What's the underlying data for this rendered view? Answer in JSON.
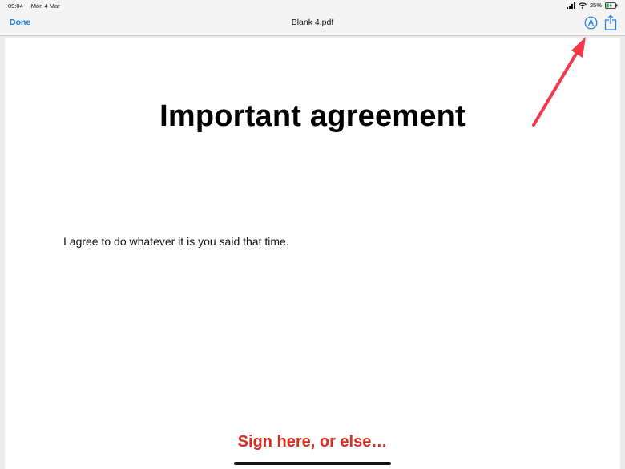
{
  "status_bar": {
    "time": "09:04",
    "date": "Mon 4 Mar",
    "battery": "25%"
  },
  "nav": {
    "done_label": "Done",
    "title": "Blank 4.pdf"
  },
  "document": {
    "heading": "Important agreement",
    "body": "I agree to do whatever it is you said that time.",
    "sign_prompt": "Sign here, or else…"
  },
  "colors": {
    "accent": "#1a7cf0",
    "annotation_arrow": "#f0394a",
    "sign_text": "#d62e1f"
  },
  "icons": {
    "markup": "markup-pen-icon",
    "share": "share-icon",
    "signal": "cellular-signal-icon",
    "wifi": "wifi-icon",
    "battery": "battery-charging-icon"
  }
}
